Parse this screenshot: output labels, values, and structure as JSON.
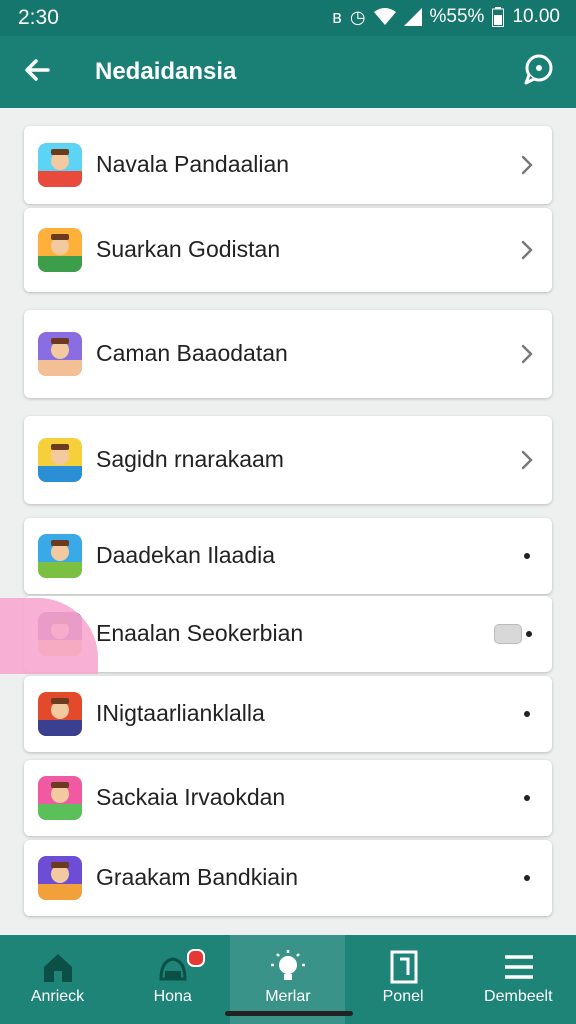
{
  "status_bar": {
    "time": "2:30",
    "battery_text": "%55%",
    "clock": "10.00"
  },
  "app_bar": {
    "title": "Nedaidansia",
    "back_icon": "arrow-back-icon",
    "chat_icon": "chat-bubble-icon"
  },
  "list": {
    "items": [
      {
        "label": "Navala Pandaalian",
        "trailing": "chevron"
      },
      {
        "label": "Suarkan Godistan",
        "trailing": "chevron"
      },
      {
        "label": "Caman Baaodatan",
        "trailing": "chevron"
      },
      {
        "label": "Sagidn rnarakaam",
        "trailing": "chevron"
      },
      {
        "label": "Daadekan Ilaadia",
        "trailing": "dot"
      },
      {
        "label": "Enaalan Seokerbian",
        "trailing": "toggle"
      },
      {
        "label": "INigtaarlianklalla",
        "trailing": "dot"
      },
      {
        "label": "Sackaia Irvaokdan",
        "trailing": "dot"
      },
      {
        "label": "Graakam Bandkiain",
        "trailing": "dot"
      }
    ]
  },
  "bottom_nav": {
    "items": [
      {
        "label": "Anrieck",
        "icon": "home-icon"
      },
      {
        "label": "Hona",
        "icon": "notification-icon"
      },
      {
        "label": "Merlar",
        "icon": "lightbulb-icon"
      },
      {
        "label": "Ponel",
        "icon": "panel-icon"
      },
      {
        "label": "Dembeelt",
        "icon": "menu-icon"
      }
    ]
  },
  "colors": {
    "primary": "#1a7f74",
    "status_bar": "#14766c",
    "nav": "#1f8478",
    "background": "#eef0f0"
  }
}
